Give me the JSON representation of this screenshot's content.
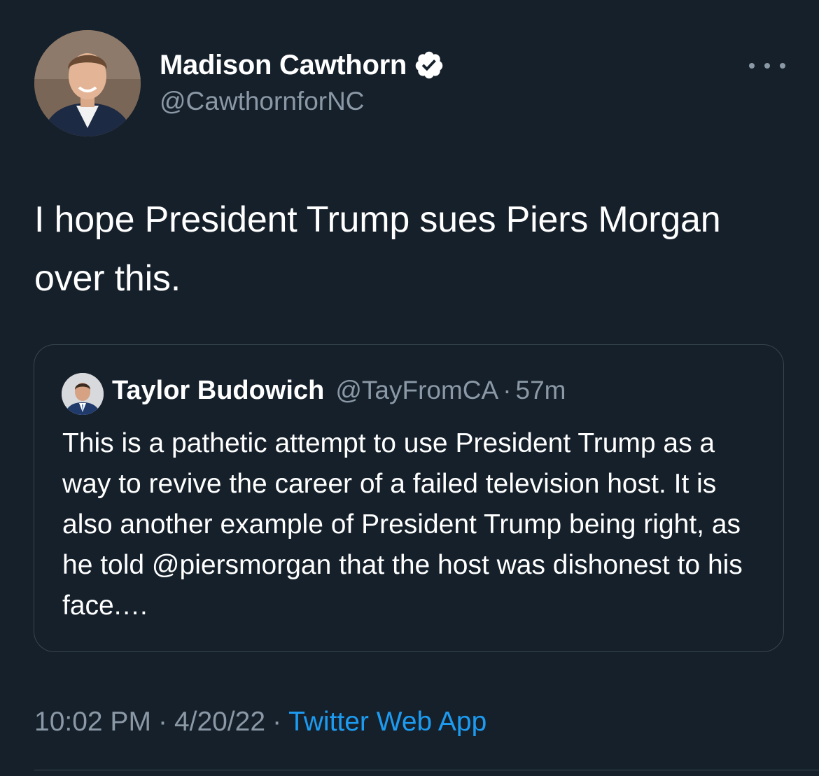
{
  "author": {
    "display_name": "Madison Cawthorn",
    "handle": "@CawthornforNC",
    "verified": true,
    "avatar_icon": "profile-photo-icon"
  },
  "more_menu_icon": "more-horizontal-icon",
  "tweet": {
    "text": "I hope President Trump sues Piers Morgan over this."
  },
  "quoted_tweet": {
    "display_name": "Taylor Budowich",
    "handle": "@TayFromCA",
    "separator": "·",
    "time": "57m",
    "text": "This is a pathetic attempt to use President Trump as a way to revive the career of a failed television host. It is also another example of President Trump being right, as he told @piersmorgan that the host was dishonest to his face.…"
  },
  "meta": {
    "time": "10:02 PM",
    "separator": "·",
    "date": "4/20/22",
    "source": "Twitter Web App"
  },
  "colors": {
    "background": "#15202b",
    "secondary_text": "#8b98a5",
    "link": "#1d9bf0",
    "border": "#38444d"
  }
}
